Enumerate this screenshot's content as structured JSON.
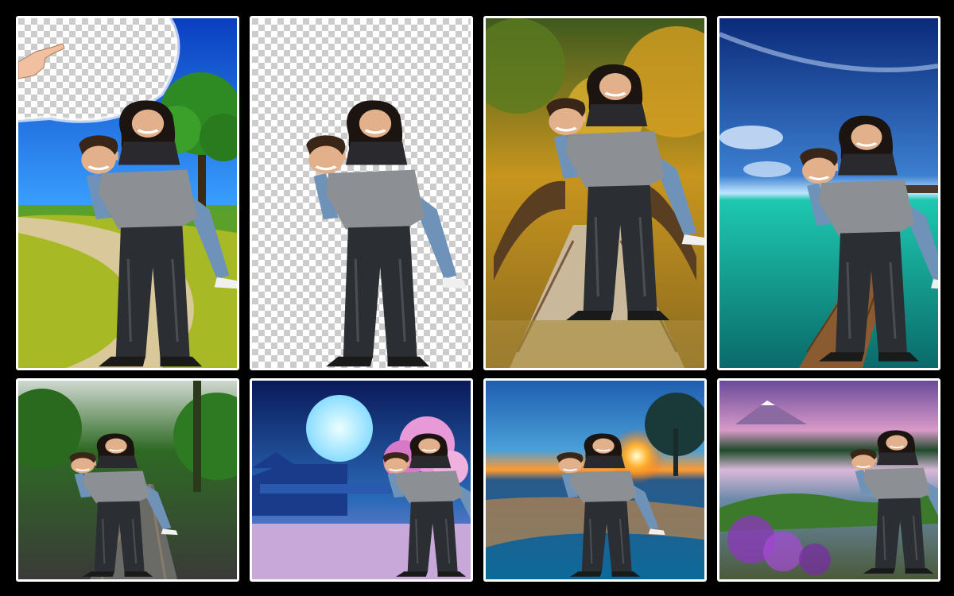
{
  "gallery": {
    "tiles": [
      {
        "scene": "meadow-eraser"
      },
      {
        "scene": "transparent-cutout"
      },
      {
        "scene": "autumn-bridge"
      },
      {
        "scene": "sea-pier"
      },
      {
        "scene": "railway-forest"
      },
      {
        "scene": "moon-pavilion"
      },
      {
        "scene": "sunset-lake"
      },
      {
        "scene": "purple-lake"
      }
    ]
  },
  "colors": {
    "page_background": "#000000",
    "tile_border": "#ffffff",
    "checker_light": "#ffffff",
    "checker_dark": "#cccccc",
    "sweater": "#8c8f94",
    "jeans_dark": "#2b2e33",
    "jeans_light": "#6f93b8",
    "hair": "#1c1410",
    "skin": "#e2b08a"
  },
  "icons": [
    "hand-pointer-icon"
  ]
}
